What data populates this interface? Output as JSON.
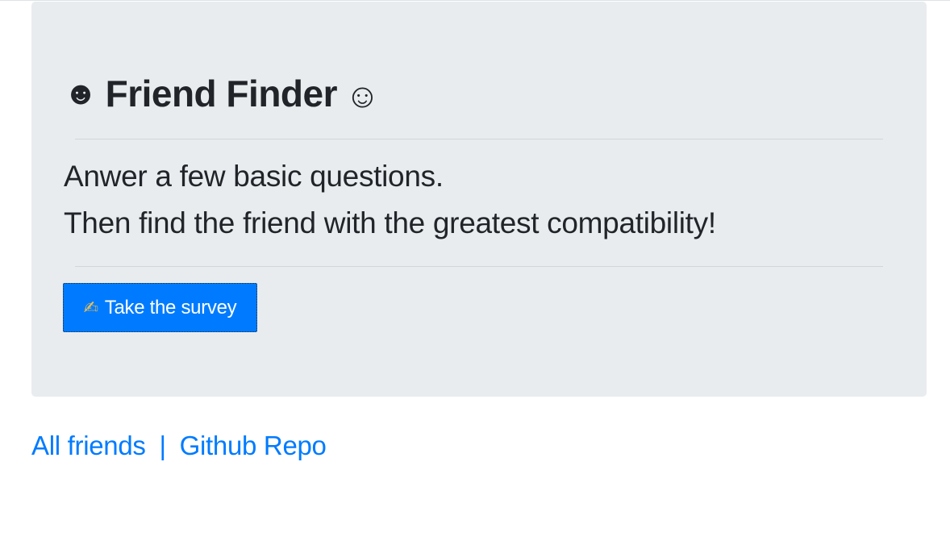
{
  "header": {
    "title": "Friend Finder",
    "left_icon": "☻",
    "right_icon": "☺"
  },
  "intro": {
    "line1": "Anwer a few basic questions.",
    "line2": "Then find the friend with the greatest compatibility!"
  },
  "survey_button": {
    "icon": "✍",
    "label": "Take the survey"
  },
  "footer_links": {
    "all_friends": "All friends",
    "separator": "|",
    "github_repo": "Github Repo"
  },
  "colors": {
    "primary": "#007bff",
    "jumbotron_bg": "#e9ecef",
    "text": "#212529"
  }
}
